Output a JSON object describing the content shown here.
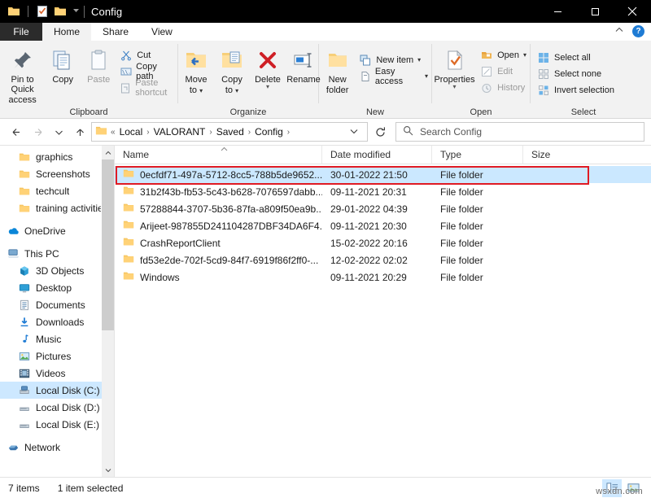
{
  "window": {
    "title": "Config",
    "quick_access_icons": [
      "folder-icon",
      "properties-icon",
      "folder-new-icon",
      "chevron-down-icon"
    ],
    "controls": {
      "minimize": "minimize-icon",
      "maximize": "maximize-icon",
      "close": "close-icon"
    }
  },
  "tabs": [
    {
      "label": "File",
      "active": false
    },
    {
      "label": "Home",
      "active": true
    },
    {
      "label": "Share",
      "active": false
    },
    {
      "label": "View",
      "active": false
    }
  ],
  "ribbon": {
    "collapse_icon": "chevron-up-icon",
    "help_label": "?",
    "groups": [
      {
        "name": "Clipboard",
        "label": "Clipboard",
        "big_buttons": [
          {
            "label": "Pin to Quick\naccess",
            "line1": "Pin to Quick",
            "line2": "access",
            "icon": "pin-icon",
            "disabled": false
          },
          {
            "label": "Copy",
            "line1": "Copy",
            "line2": "",
            "icon": "copy-icon",
            "disabled": false
          },
          {
            "label": "Paste",
            "line1": "Paste",
            "line2": "",
            "icon": "paste-icon",
            "disabled": true
          }
        ],
        "small_buttons": [
          {
            "label": "Cut",
            "icon": "cut-icon",
            "disabled": false
          },
          {
            "label": "Copy path",
            "icon": "copy-path-icon",
            "disabled": false
          },
          {
            "label": "Paste shortcut",
            "icon": "paste-shortcut-icon",
            "disabled": true
          }
        ]
      },
      {
        "name": "Organize",
        "label": "Organize",
        "big_buttons": [
          {
            "line1": "Move",
            "line2": "to",
            "icon": "move-to-icon",
            "has_caret": true,
            "disabled": false
          },
          {
            "line1": "Copy",
            "line2": "to",
            "icon": "copy-to-icon",
            "has_caret": true,
            "disabled": false
          },
          {
            "line1": "Delete",
            "line2": "",
            "icon": "delete-icon",
            "has_caret": true,
            "disabled": false
          },
          {
            "line1": "Rename",
            "line2": "",
            "icon": "rename-icon",
            "has_caret": false,
            "disabled": false
          }
        ],
        "small_buttons": []
      },
      {
        "name": "New",
        "label": "New",
        "big_buttons": [
          {
            "line1": "New",
            "line2": "folder",
            "icon": "new-folder-icon",
            "has_caret": false,
            "disabled": false
          }
        ],
        "small_buttons": [
          {
            "label": "New item",
            "icon": "new-item-icon",
            "has_caret": true,
            "disabled": false
          },
          {
            "label": "Easy access",
            "icon": "easy-access-icon",
            "has_caret": true,
            "disabled": false
          }
        ]
      },
      {
        "name": "Open",
        "label": "Open",
        "big_buttons": [
          {
            "line1": "Properties",
            "line2": "",
            "icon": "properties-icon",
            "has_caret": true,
            "disabled": false
          }
        ],
        "small_buttons": [
          {
            "label": "Open",
            "icon": "open-folder-icon",
            "has_caret": true,
            "disabled": false
          },
          {
            "label": "Edit",
            "icon": "edit-icon",
            "disabled": true
          },
          {
            "label": "History",
            "icon": "history-icon",
            "disabled": true
          }
        ]
      },
      {
        "name": "Select",
        "label": "Select",
        "big_buttons": [],
        "small_buttons": [
          {
            "label": "Select all",
            "icon": "select-all-icon",
            "disabled": false
          },
          {
            "label": "Select none",
            "icon": "select-none-icon",
            "disabled": false
          },
          {
            "label": "Invert selection",
            "icon": "invert-selection-icon",
            "disabled": false
          }
        ]
      }
    ]
  },
  "navbar": {
    "back": "back-arrow-icon",
    "forward": "forward-arrow-icon",
    "recent": "chevron-down-icon",
    "up": "up-arrow-icon",
    "path_icon": "folder-icon",
    "overflow": "«",
    "breadcrumbs": [
      "Local",
      "VALORANT",
      "Saved",
      "Config"
    ],
    "dropdown": "chevron-down-icon",
    "refresh": "refresh-icon",
    "search": {
      "icon": "search-icon",
      "placeholder": "Search Config",
      "value": ""
    }
  },
  "nav_pane": {
    "scroll_up": "chevron-up-icon",
    "scroll_down": "chevron-down-icon",
    "groups": [
      {
        "items": [
          {
            "label": "graphics",
            "icon": "folder-icon",
            "indent": 2,
            "selected": false
          },
          {
            "label": "Screenshots",
            "icon": "folder-icon",
            "indent": 2,
            "selected": false
          },
          {
            "label": "techcult",
            "icon": "folder-icon",
            "indent": 2,
            "selected": false
          },
          {
            "label": "training activities",
            "icon": "folder-icon",
            "indent": 2,
            "selected": false
          }
        ]
      },
      {
        "items": [
          {
            "label": "OneDrive",
            "icon": "onedrive-icon",
            "indent": 1,
            "selected": false
          }
        ]
      },
      {
        "items": [
          {
            "label": "This PC",
            "icon": "this-pc-icon",
            "indent": 1,
            "selected": false
          },
          {
            "label": "3D Objects",
            "icon": "3d-objects-icon",
            "indent": 2,
            "selected": false
          },
          {
            "label": "Desktop",
            "icon": "desktop-icon",
            "indent": 2,
            "selected": false
          },
          {
            "label": "Documents",
            "icon": "documents-icon",
            "indent": 2,
            "selected": false
          },
          {
            "label": "Downloads",
            "icon": "downloads-icon",
            "indent": 2,
            "selected": false
          },
          {
            "label": "Music",
            "icon": "music-icon",
            "indent": 2,
            "selected": false
          },
          {
            "label": "Pictures",
            "icon": "pictures-icon",
            "indent": 2,
            "selected": false
          },
          {
            "label": "Videos",
            "icon": "videos-icon",
            "indent": 2,
            "selected": false
          },
          {
            "label": "Local Disk (C:)",
            "icon": "local-disk-c-icon",
            "indent": 2,
            "selected": true
          },
          {
            "label": "Local Disk (D:)",
            "icon": "local-disk-icon",
            "indent": 2,
            "selected": false
          },
          {
            "label": "Local Disk (E:)",
            "icon": "local-disk-icon",
            "indent": 2,
            "selected": false
          }
        ]
      },
      {
        "items": [
          {
            "label": "Network",
            "icon": "network-icon",
            "indent": 1,
            "selected": false
          }
        ]
      }
    ]
  },
  "file_list": {
    "columns": [
      {
        "label": "Name",
        "sorted": true,
        "sort_dir": "asc"
      },
      {
        "label": "Date modified",
        "sorted": false
      },
      {
        "label": "Type",
        "sorted": false
      },
      {
        "label": "Size",
        "sorted": false
      }
    ],
    "rows": [
      {
        "name": "0ecfdf71-497a-5712-8cc5-788b5de9652...",
        "date": "30-01-2022 21:50",
        "type": "File folder",
        "size": "",
        "icon": "folder-icon",
        "selected": true,
        "highlighted": true
      },
      {
        "name": "31b2f43b-fb53-5c43-b628-7076597dabb...",
        "date": "09-11-2021 20:31",
        "type": "File folder",
        "size": "",
        "icon": "folder-icon",
        "selected": false,
        "highlighted": false
      },
      {
        "name": "57288844-3707-5b36-87fa-a809f50ea9b...",
        "date": "29-01-2022 04:39",
        "type": "File folder",
        "size": "",
        "icon": "folder-icon",
        "selected": false,
        "highlighted": false
      },
      {
        "name": "Arijeet-987855D241104287DBF34DA6F4...",
        "date": "09-11-2021 20:30",
        "type": "File folder",
        "size": "",
        "icon": "folder-icon",
        "selected": false,
        "highlighted": false
      },
      {
        "name": "CrashReportClient",
        "date": "15-02-2022 20:16",
        "type": "File folder",
        "size": "",
        "icon": "folder-icon",
        "selected": false,
        "highlighted": false
      },
      {
        "name": "fd53e2de-702f-5cd9-84f7-6919f86f2ff0-...",
        "date": "12-02-2022 02:02",
        "type": "File folder",
        "size": "",
        "icon": "folder-icon",
        "selected": false,
        "highlighted": false
      },
      {
        "name": "Windows",
        "date": "09-11-2021 20:29",
        "type": "File folder",
        "size": "",
        "icon": "folder-icon",
        "selected": false,
        "highlighted": false
      }
    ]
  },
  "statusbar": {
    "item_count": "7 items",
    "selection": "1 item selected",
    "view_details_icon": "details-view-icon",
    "view_thumbnails_icon": "thumbnail-view-icon"
  },
  "watermark": {
    "text": "wsxdn.com"
  },
  "colors": {
    "titlebar_bg": "#000000",
    "ribbon_bg": "#f2f2f2",
    "selection_blue": "#cbe8ff",
    "highlight_red": "#e01b24",
    "folder_yellow": "#ffd277",
    "accent_blue": "#1e7bd4"
  }
}
